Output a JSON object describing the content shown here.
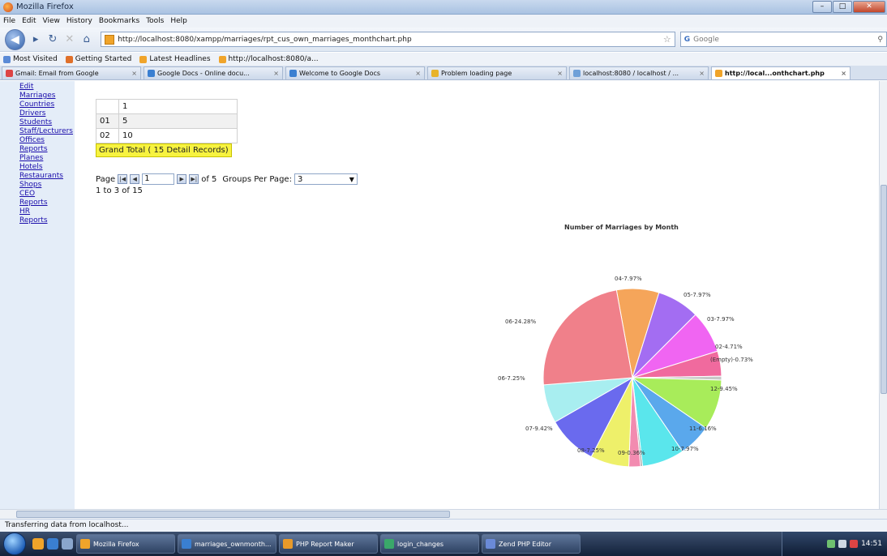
{
  "window": {
    "title": "Mozilla Firefox"
  },
  "menu": [
    "File",
    "Edit",
    "View",
    "History",
    "Bookmarks",
    "Tools",
    "Help"
  ],
  "nav": {
    "url": "http://localhost:8080/xampp/marriages/rpt_cus_own_marriages_monthchart.php",
    "search_placeholder": "Google"
  },
  "bookmarks": [
    {
      "label": "Most Visited",
      "color": "#5a8ad6"
    },
    {
      "label": "Getting Started",
      "color": "#e0702a"
    },
    {
      "label": "Latest Headlines",
      "color": "#f0a42a"
    },
    {
      "label": "http://localhost:8080/a...",
      "color": "#f0a42a"
    }
  ],
  "tabs": [
    {
      "label": "Gmail: Email from Google",
      "color": "#d44"
    },
    {
      "label": "Google Docs - Online docu...",
      "color": "#3a7fd1"
    },
    {
      "label": "Welcome to Google Docs",
      "color": "#3a7fd1"
    },
    {
      "label": "Problem loading page",
      "color": "#e8b32a"
    },
    {
      "label": "localhost:8080 / localhost / ...",
      "color": "#6fa0d8"
    },
    {
      "label": "http://local...onthchart.php",
      "color": "#f0a42a",
      "active": true
    }
  ],
  "sidebar": [
    "Edit",
    "Marriages",
    "Countries",
    "Drivers",
    "Students",
    "Staff/Lecturers",
    "Offices",
    "Reports",
    "Planes",
    "Hotels",
    "Restaurants",
    "Shops",
    "CEO",
    "Reports",
    "HR",
    "Reports"
  ],
  "table": {
    "rows": [
      {
        "c1": "",
        "c2": "1"
      },
      {
        "c1": "01",
        "c2": "5"
      },
      {
        "c1": "02",
        "c2": "10"
      }
    ],
    "grand_total": "Grand Total ( 15 Detail Records)"
  },
  "pager": {
    "page_label": "Page",
    "page_value": "1",
    "of_label": "of 5",
    "per_page_label": "Groups Per Page:",
    "per_page_value": "3",
    "record_info": "1 to 3 of 15"
  },
  "chart_data": {
    "type": "pie",
    "title": "Number of Marriages by Month",
    "slices": [
      {
        "label": "04-7.97%",
        "value": 7.97,
        "color": "#f5a55a"
      },
      {
        "label": "05-7.97%",
        "value": 7.97,
        "color": "#a36df2"
      },
      {
        "label": "03-7.97%",
        "value": 7.97,
        "color": "#f065f2"
      },
      {
        "label": "02-4.71%",
        "value": 4.71,
        "color": "#f06a9e"
      },
      {
        "label": "(Empty)-0.73%",
        "value": 0.73,
        "color": "#c8c8c8"
      },
      {
        "label": "12-9.42%",
        "value": 9.42,
        "color": "#a8ec5a"
      },
      {
        "label": "11-6.16%",
        "value": 6.16,
        "color": "#5aa8ec"
      },
      {
        "label": "10-7.97%",
        "value": 7.97,
        "color": "#5ae6ec"
      },
      {
        "label": "09-0.36%",
        "value": 0.36,
        "color": "#a0a0a0"
      },
      {
        "label": "08-7.25%",
        "value": 7.25,
        "color": "#f28bb0"
      },
      {
        "label": "07-9.42%",
        "value": 7.97,
        "color": "#eef06a"
      },
      {
        "label": "06-7.25%",
        "value": 9.42,
        "color": "#6a6aee"
      },
      {
        "label": "06-24.28%",
        "value": 7.25,
        "color": "#a8eef0"
      },
      {
        "label": "06-24.28%",
        "value": 24.28,
        "color": "#f0808a"
      }
    ],
    "printed_labels": [
      "04-7.97%",
      "05-7.97%",
      "03-7.97%",
      "02-4.71%",
      "(Empty)-0.73%",
      "12-9.45%",
      "11-6.16%",
      "10-7.97%",
      "09-0.36%",
      "08-7.25%",
      "07-9.42%",
      "06-7.25%",
      "06-24.28%"
    ]
  },
  "status": "Transferring data from localhost...",
  "taskbar": [
    {
      "label": "Mozilla Firefox",
      "color": "#f0a42a"
    },
    {
      "label": "marriages_ownmonth...",
      "color": "#3a7fd1"
    },
    {
      "label": "PHP Report Maker",
      "color": "#e89a2a"
    },
    {
      "label": "login_changes",
      "color": "#3aa86a"
    },
    {
      "label": "Zend PHP Editor",
      "color": "#6a8ad8"
    }
  ],
  "clock": "14:51"
}
